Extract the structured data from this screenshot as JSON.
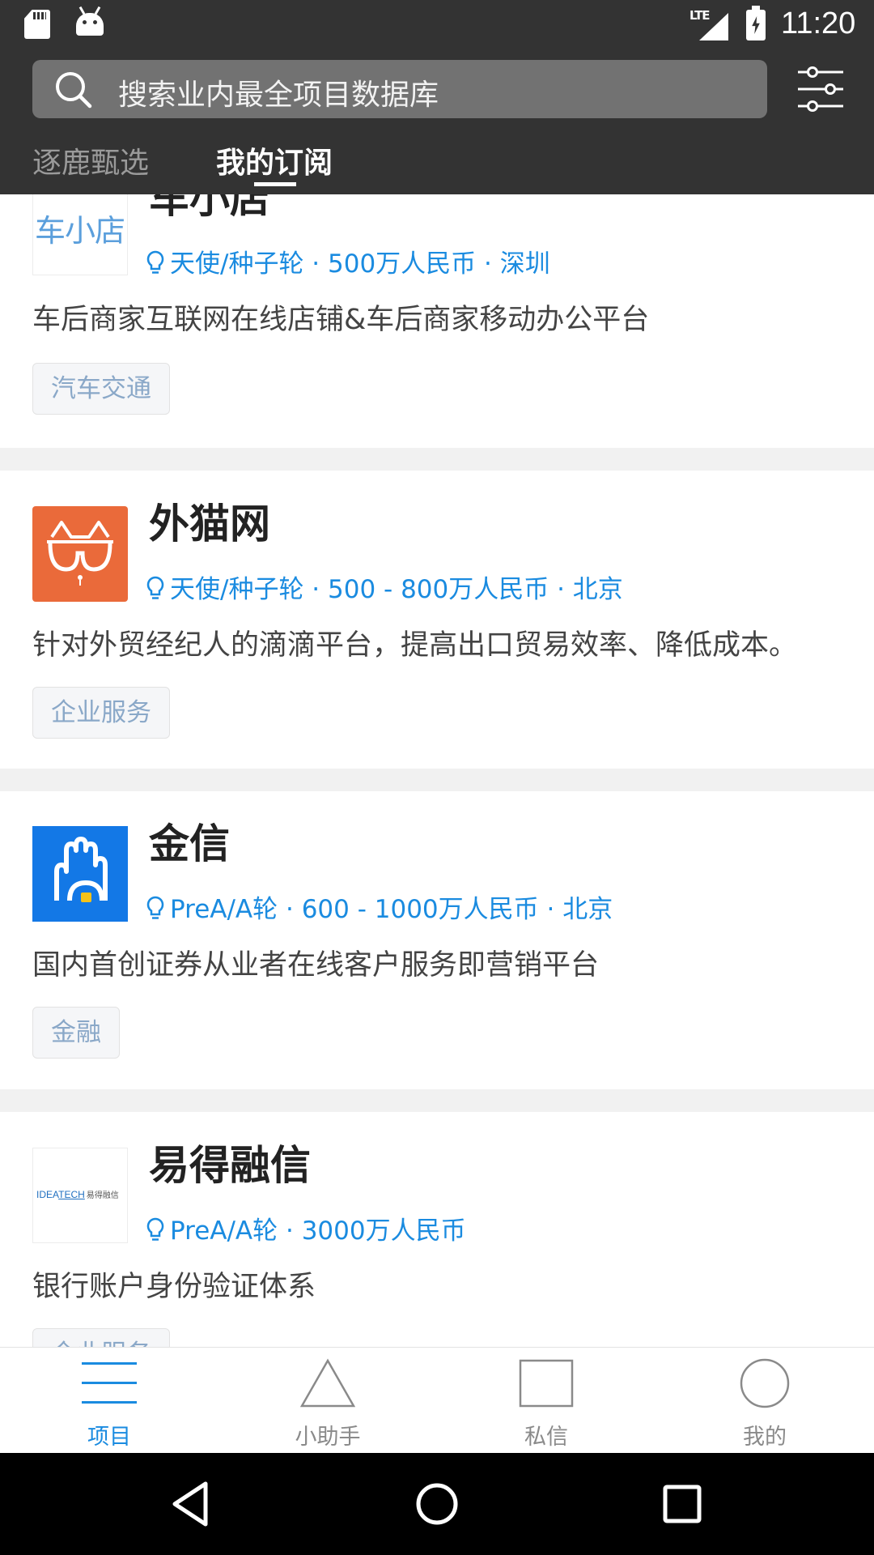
{
  "status_bar": {
    "time": "11:20",
    "network": "LTE"
  },
  "search": {
    "placeholder": "搜索业内最全项目数据库"
  },
  "tabs": [
    {
      "label": "逐鹿甄选",
      "active": false
    },
    {
      "label": "我的订阅",
      "active": true
    }
  ],
  "projects": [
    {
      "name": "车小店",
      "logo_text": "车小店",
      "round": "天使/种子轮",
      "amount": "500万人民币",
      "city": "深圳",
      "meta": "天使/种子轮 · 500万人民币 · 深圳",
      "description": "车后商家互联网在线店铺&车后商家移动办公平台",
      "tag": "汽车交通"
    },
    {
      "name": "外猫网",
      "round": "天使/种子轮",
      "amount": "500 - 800万人民币",
      "city": "北京",
      "meta": "天使/种子轮 · 500 - 800万人民币 · 北京",
      "description": "针对外贸经纪人的滴滴平台，提高出口贸易效率、降低成本。",
      "tag": "企业服务"
    },
    {
      "name": "金信",
      "round": "PreA/A轮",
      "amount": "600 - 1000万人民币",
      "city": "北京",
      "meta": "PreA/A轮 · 600 - 1000万人民币 · 北京",
      "description": "国内首创证券从业者在线客户服务即营销平台",
      "tag": "金融"
    },
    {
      "name": "易得融信",
      "logo_text_a": "IDEA",
      "logo_text_b": "TECH",
      "logo_text_c": "易得融信",
      "round": "PreA/A轮",
      "amount": "3000万人民币",
      "meta": "PreA/A轮 · 3000万人民币",
      "description": "银行账户身份验证体系",
      "tag": "企业服务"
    }
  ],
  "bottom_nav": [
    {
      "label": "项目",
      "icon": "menu-icon",
      "active": true
    },
    {
      "label": "小助手",
      "icon": "triangle-icon",
      "active": false
    },
    {
      "label": "私信",
      "icon": "square-icon",
      "active": false
    },
    {
      "label": "我的",
      "icon": "circle-icon",
      "active": false
    }
  ],
  "colors": {
    "header_bg": "#333333",
    "accent": "#1a8be0",
    "tag_text": "#8aa8c8",
    "separator": "#f1f1f1"
  }
}
